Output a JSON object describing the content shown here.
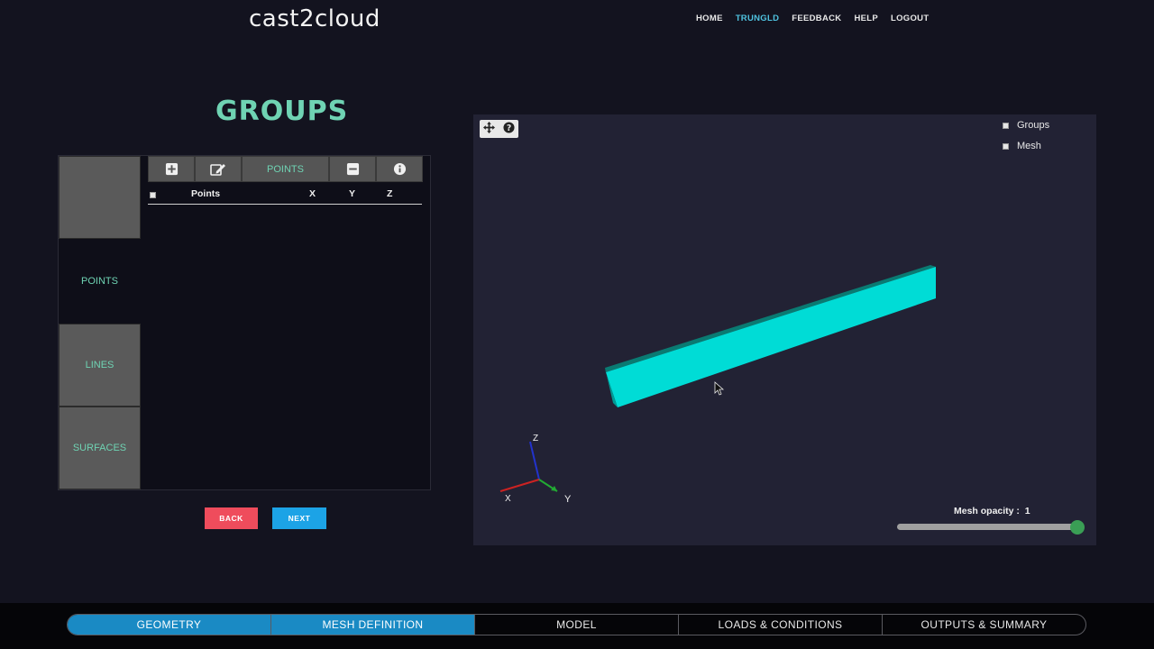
{
  "header": {
    "logo": "cast2cloud",
    "nav": [
      "HOME",
      "TRUNGLD",
      "FEEDBACK",
      "HELP",
      "LOGOUT"
    ],
    "active_nav": "TRUNGLD"
  },
  "page": {
    "title": "GROUPS"
  },
  "sidebar": {
    "tabs": [
      {
        "label": ""
      },
      {
        "label": "POINTS"
      },
      {
        "label": "LINES"
      },
      {
        "label": "SURFACES"
      }
    ],
    "active_tab": "POINTS"
  },
  "toolbar": {
    "add_icon": "plus-square-icon",
    "edit_icon": "edit-icon",
    "label": "POINTS",
    "remove_icon": "minus-square-icon",
    "info_icon": "info-circle-icon"
  },
  "table": {
    "columns": [
      "Points",
      "X",
      "Y",
      "Z"
    ],
    "rows": []
  },
  "buttons": {
    "back": "BACK",
    "next": "NEXT"
  },
  "viewer": {
    "tools": [
      "move-icon",
      "help-icon"
    ],
    "legend": [
      {
        "label": "Groups",
        "checked": true
      },
      {
        "label": "Mesh",
        "checked": true
      }
    ],
    "opacity_label": "Mesh opacity :",
    "opacity_value": "1",
    "axes": {
      "x": "X",
      "y": "Y",
      "z": "Z"
    },
    "mesh_color": "#00e0dc"
  },
  "steps": [
    {
      "label": "GEOMETRY",
      "done": true
    },
    {
      "label": "MESH DEFINITION",
      "done": true
    },
    {
      "label": "MODEL",
      "done": false
    },
    {
      "label": "LOADS & CONDITIONS",
      "done": false
    },
    {
      "label": "OUTPUTS & SUMMARY",
      "done": false
    }
  ],
  "colors": {
    "accent": "#6fd3b3",
    "link_active": "#4fc3e0",
    "back_button": "#ef4c5c",
    "next_button": "#1ca3e6",
    "step_done": "#1a8ac4"
  }
}
